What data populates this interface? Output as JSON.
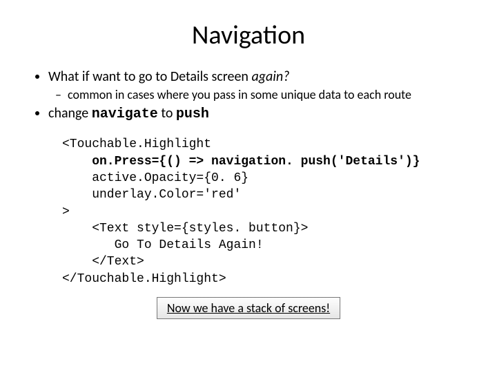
{
  "title": "Navigation",
  "bullets": {
    "b1_prefix": "What if want to go to Details screen ",
    "b1_italic": "again?",
    "b1_sub": "common in cases where you pass in some unique data to each route",
    "b2_prefix": "change ",
    "b2_code1": "navigate",
    "b2_mid": " to ",
    "b2_code2": "push"
  },
  "code": {
    "l1": "<Touchable.Highlight",
    "l2": "    on.Press={() => navigation. push('Details')}",
    "l3": "    active.Opacity={0. 6}",
    "l4": "    underlay.Color='red'",
    "l5": ">",
    "l6": "    <Text style={styles. button}>",
    "l7": "       Go To Details Again!",
    "l8": "    </Text>",
    "l9": "</Touchable.Highlight>"
  },
  "caption": "Now we have a stack of screens!"
}
